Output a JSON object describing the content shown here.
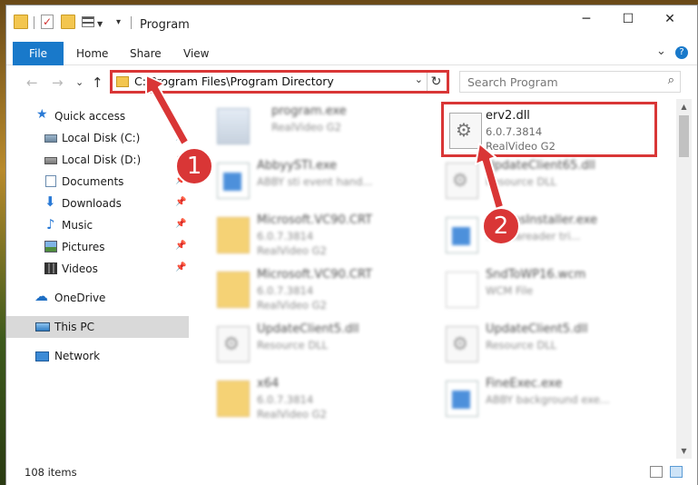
{
  "window": {
    "title": "Program",
    "controls": {
      "minimize": "─",
      "maximize": "☐",
      "close": "✕"
    }
  },
  "ribbon": {
    "tabs": [
      "File",
      "Home",
      "Share",
      "View"
    ],
    "collapse_glyph": "⌄",
    "help_glyph": "?"
  },
  "navigation": {
    "back": "←",
    "forward": "→",
    "recent": "⌄",
    "up": "↑",
    "address": "C:\\Program Files\\Program Directory",
    "address_chevron": "⌄",
    "refresh": "↻",
    "search_placeholder": "Search Program",
    "search_glyph": "⌕"
  },
  "sidebar": {
    "items": [
      {
        "label": "Quick access",
        "icon": "quick-access-star-icon",
        "pinned": false
      },
      {
        "label": "Local Disk (C:)",
        "icon": "drive-icon",
        "pinned": true
      },
      {
        "label": "Local Disk (D:)",
        "icon": "drive-icon",
        "pinned": true
      },
      {
        "label": "Documents",
        "icon": "documents-icon",
        "pinned": true
      },
      {
        "label": "Downloads",
        "icon": "downloads-icon",
        "pinned": true
      },
      {
        "label": "Music",
        "icon": "music-icon",
        "pinned": true
      },
      {
        "label": "Pictures",
        "icon": "pictures-icon",
        "pinned": true
      },
      {
        "label": "Videos",
        "icon": "videos-icon",
        "pinned": true
      },
      {
        "label": "OneDrive",
        "icon": "onedrive-icon",
        "pinned": false
      },
      {
        "label": "This PC",
        "icon": "this-pc-icon",
        "pinned": false,
        "selected": true
      },
      {
        "label": "Network",
        "icon": "network-icon",
        "pinned": false
      }
    ],
    "pin_glyph": "📌"
  },
  "files": {
    "highlighted": {
      "name": "erv2.dll",
      "line1": "6.0.7.3814",
      "line2": "RealVideo G2",
      "icon": "dll-file-icon"
    },
    "blurred": [
      {
        "name": "program.exe",
        "line1": "RealVideo G2",
        "line2": "",
        "icon": "exe-file-icon"
      },
      {
        "name": "AbbyySTI.exe",
        "line1": "ABBY sti event hand...",
        "line2": "",
        "icon": "exe-file-icon"
      },
      {
        "name": "UpdateClient65.dll",
        "line1": "Resource DLL",
        "line2": "",
        "icon": "dll-file-icon"
      },
      {
        "name": "Microsoft.VC90.CRT",
        "line1": "6.0.7.3814",
        "line2": "RealVideo G2",
        "icon": "folder-icon"
      },
      {
        "name": "...mmsInstaller.exe",
        "line1": "...fineareader tri...",
        "line2": "",
        "icon": "exe-file-icon"
      },
      {
        "name": "Microsoft.VC90.CRT",
        "line1": "6.0.7.3814",
        "line2": "RealVideo G2",
        "icon": "folder-icon"
      },
      {
        "name": "SndToWP16.wcm",
        "line1": "WCM File",
        "line2": "",
        "icon": "wcm-file-icon"
      },
      {
        "name": "UpdateClient5.dll",
        "line1": "Resource DLL",
        "line2": "",
        "icon": "dll-file-icon"
      },
      {
        "name": "UpdateClient5.dll",
        "line1": "Resource DLL",
        "line2": "",
        "icon": "dll-file-icon"
      },
      {
        "name": "x64",
        "line1": "6.0.7.3814",
        "line2": "RealVideo G2",
        "icon": "folder-icon"
      },
      {
        "name": "FineExec.exe",
        "line1": "ABBY background exe...",
        "line2": "",
        "icon": "exe-file-icon"
      }
    ]
  },
  "status": {
    "item_count": "108 items"
  },
  "callouts": {
    "step1": "1",
    "step2": "2",
    "color": "#d93636"
  }
}
